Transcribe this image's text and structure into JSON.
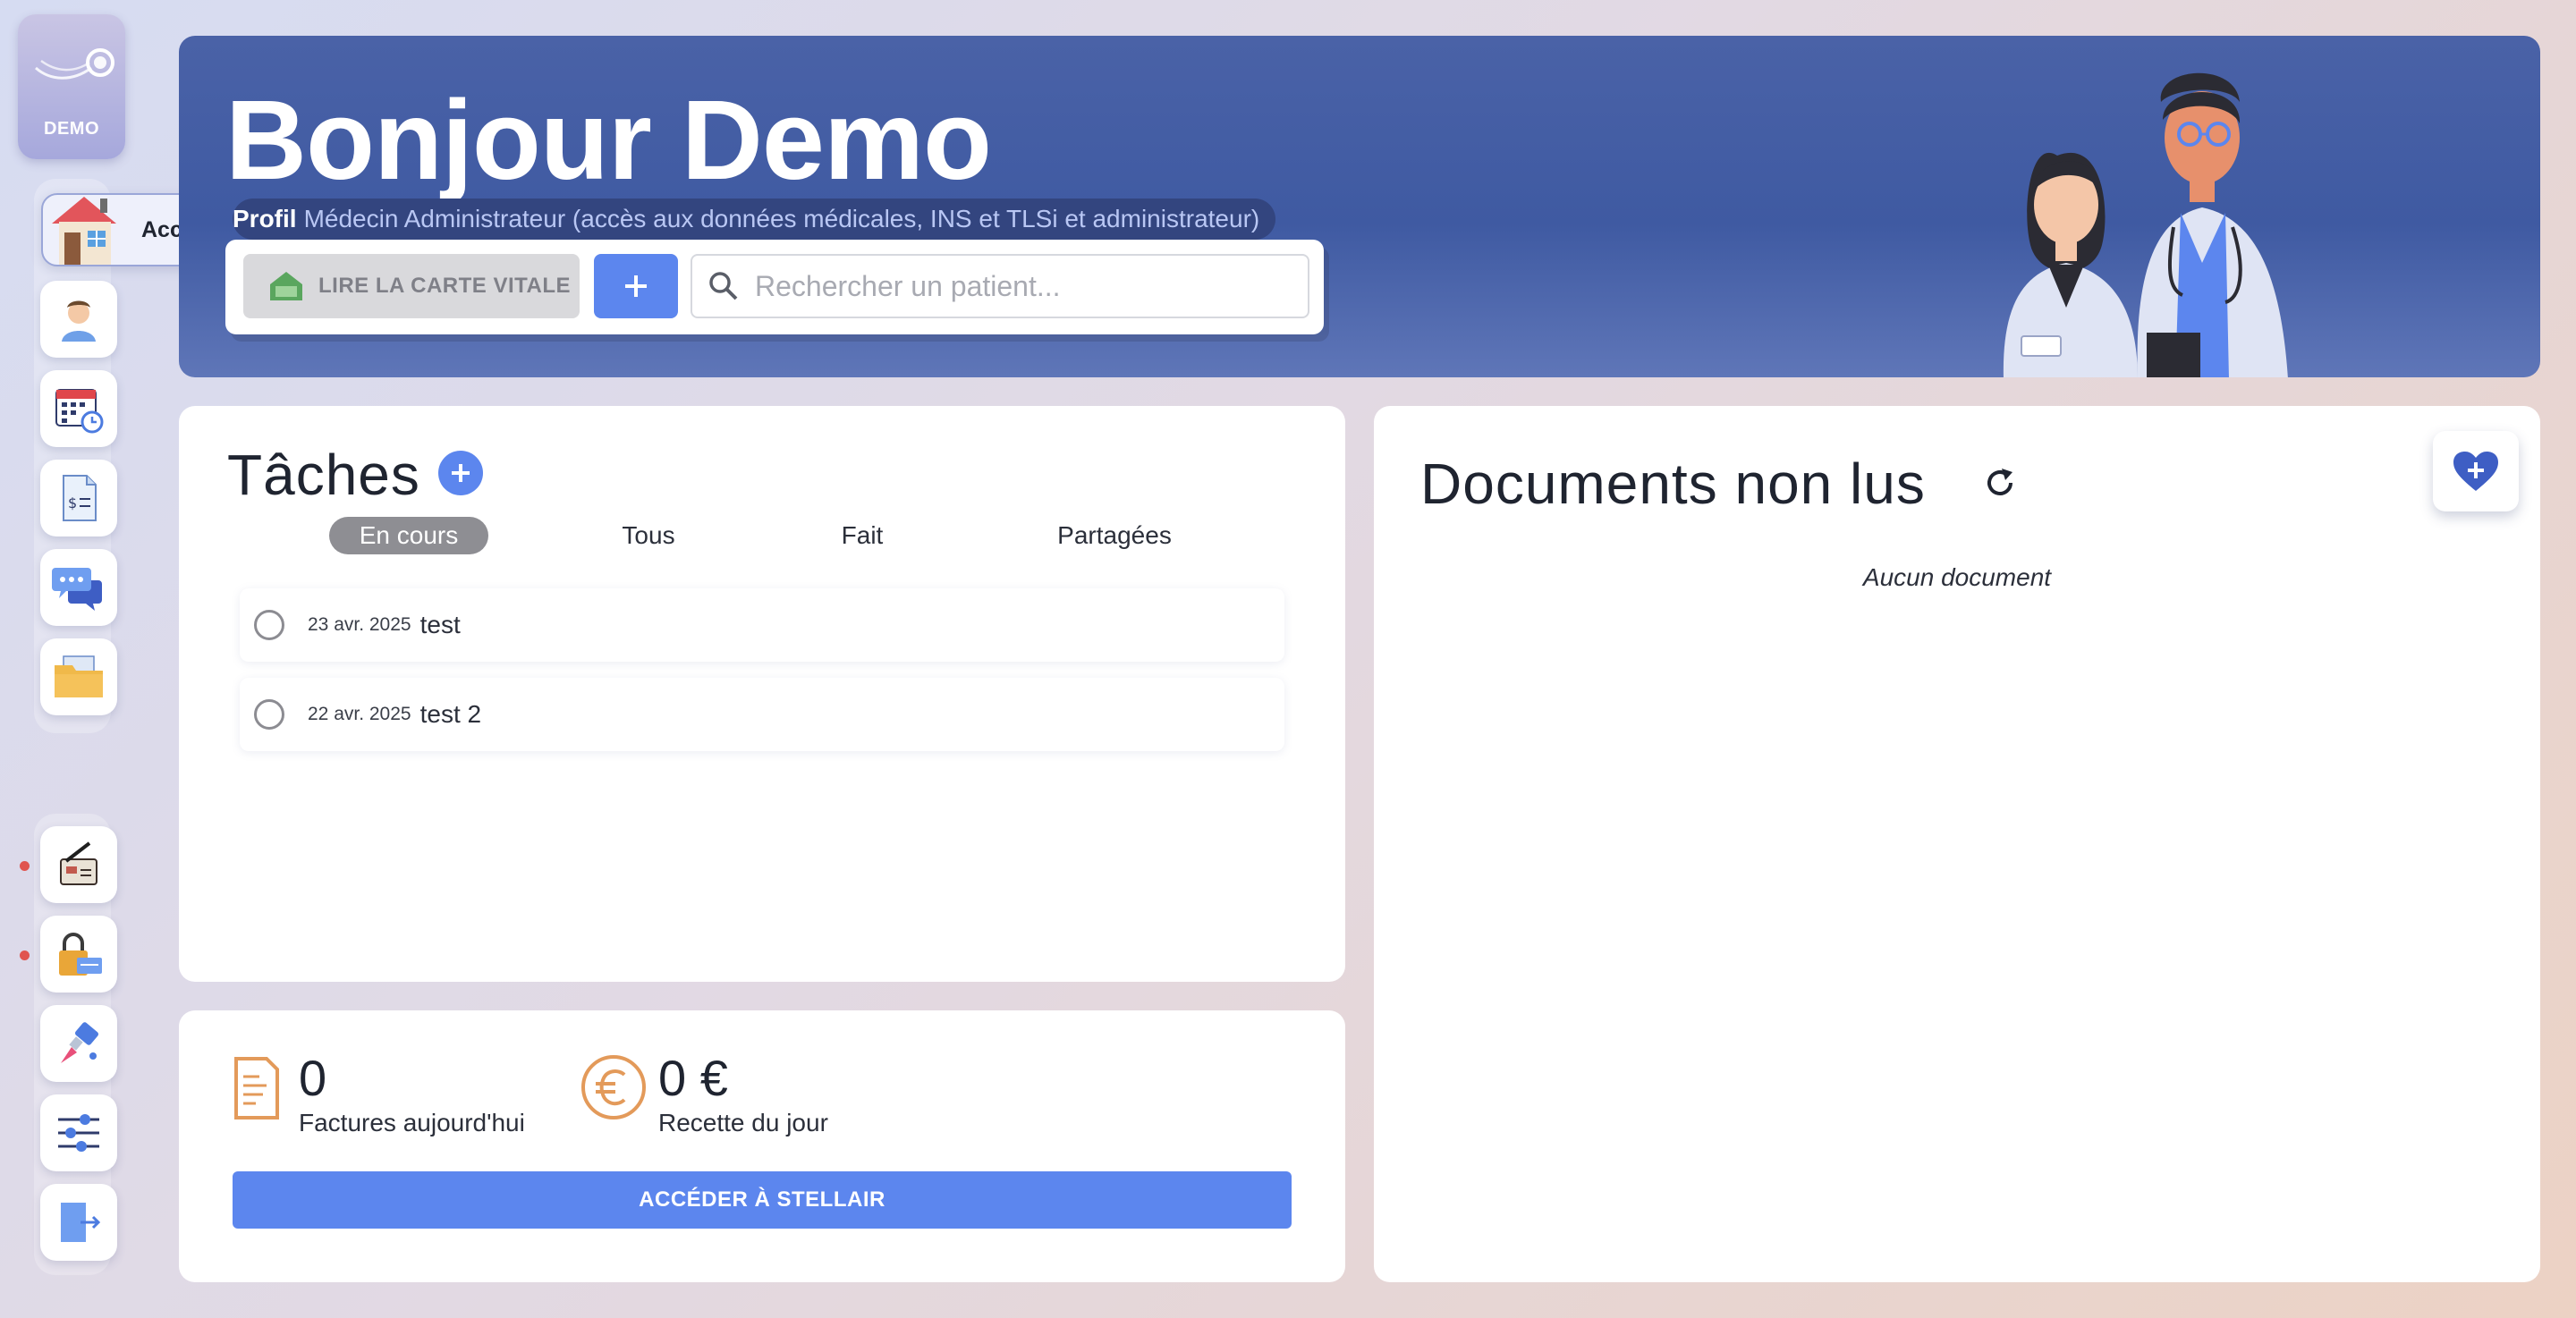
{
  "brand": {
    "logo_text": "DEMO",
    "accent": "#5c86ee",
    "banner_color": "#4a62a7"
  },
  "sidebar": {
    "active_label": "Accueil",
    "items": [
      {
        "name": "home-icon",
        "label": "Accueil",
        "active": true
      },
      {
        "name": "patient-icon"
      },
      {
        "name": "calendar-icon"
      },
      {
        "name": "invoice-icon"
      },
      {
        "name": "messages-icon"
      },
      {
        "name": "folder-icon"
      }
    ],
    "bottom_items": [
      {
        "name": "card-reader-icon",
        "alert": true
      },
      {
        "name": "lock-card-icon",
        "alert": true
      },
      {
        "name": "brush-icon"
      },
      {
        "name": "settings-sliders-icon"
      },
      {
        "name": "logout-icon"
      }
    ]
  },
  "header": {
    "title": "Bonjour Demo",
    "profil_label": "Profil",
    "profil_text": "Médecin Administrateur (accès aux données médicales, INS et TLSi et administrateur)",
    "vitale_button": "LIRE LA CARTE VITALE",
    "add_button": "+",
    "search_placeholder": "Rechercher un patient..."
  },
  "tasks": {
    "title": "Tâches",
    "tabs": [
      {
        "label": "En cours",
        "active": true
      },
      {
        "label": "Tous",
        "active": false
      },
      {
        "label": "Fait",
        "active": false
      },
      {
        "label": "Partagées",
        "active": false
      }
    ],
    "items": [
      {
        "date": "23 avr. 2025",
        "name": "test",
        "done": false
      },
      {
        "date": "22 avr. 2025",
        "name": "test 2",
        "done": false
      }
    ]
  },
  "documents": {
    "title": "Documents non lus",
    "empty_text": "Aucun document"
  },
  "stats": {
    "invoices_value": "0",
    "invoices_label": "Factures aujourd'hui",
    "revenue_value": "0 €",
    "revenue_label": "Recette du jour",
    "stellair_button": "ACCÉDER À STELLAIR"
  }
}
